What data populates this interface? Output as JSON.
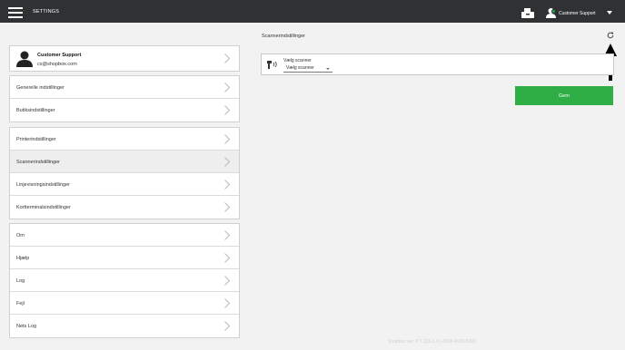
{
  "topbar": {
    "title": "SETTINGS",
    "user_name": "Customer Support",
    "colors": {
      "background": "#2f3133",
      "online": "#27a844"
    },
    "icons": [
      "hamburger-icon",
      "cash-drawer-icon",
      "user-icon",
      "chevron-down-icon"
    ]
  },
  "profile": {
    "name": "Customer Support",
    "email": "cs@shopbox.com"
  },
  "menu": {
    "general": "Generelle indstillinger",
    "store": "Butiksindstillinger",
    "printer": "Printerindstillinger",
    "scanner": "Scannerindstillinger",
    "line_display": "Linjevisningsindstillinger",
    "card_terminal": "Kortterminalsindstillinger",
    "about": "Om",
    "help": "Hjælp",
    "log": "Log",
    "error": "Fejl",
    "nets_log": "Nets Log"
  },
  "panel": {
    "title": "Scannerindstillinger",
    "scanner_caption": "Vælg scanner",
    "scanner_value": "Vælg scanner",
    "save_label": "Gem",
    "save_color": "#2fae45"
  },
  "footer": {
    "version": "Shopbox ver. P 1.226.1.0 | 4526-4929-5992"
  }
}
